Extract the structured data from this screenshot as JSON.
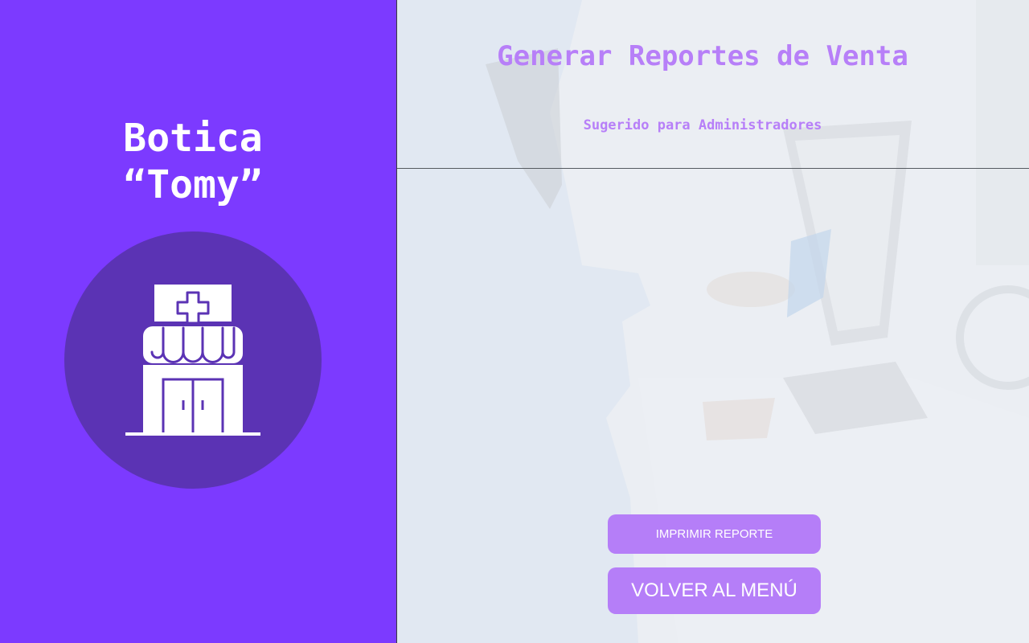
{
  "sidebar": {
    "brand_line1": "Botica",
    "brand_line2": "“Tomy”",
    "logo_icon": "pharmacy-store-icon"
  },
  "main": {
    "title": "Generar Reportes de Venta",
    "subtitle": "Sugerido para Administradores",
    "buttons": {
      "print_label": "IMPRIMIR REPORTE",
      "back_label": "VOLVER AL MENÚ"
    }
  },
  "colors": {
    "sidebar_bg": "#7c3aff",
    "logo_circle": "#5b33b4",
    "accent_text": "#b77ff8",
    "button_bg": "#b57ef8"
  }
}
